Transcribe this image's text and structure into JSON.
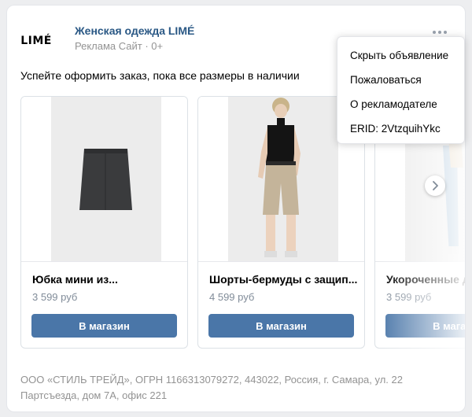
{
  "post": {
    "author": "Женская одежда LIMÉ",
    "meta": "Реклама Сайт · 0+",
    "text": "Успейте оформить заказ, пока все размеры в наличии",
    "logo_text": "LIMÉ",
    "menu_icon": "more-dots-icon"
  },
  "menu": {
    "items": [
      "Скрыть объявление",
      "Пожаловаться",
      "О рекламодателе",
      "ERID: 2VtzquihYkc"
    ]
  },
  "cards": [
    {
      "title": "Юбка мини из...",
      "price": "3 599 руб",
      "button": "В магазин"
    },
    {
      "title": "Шорты-бермуды с защип...",
      "price": "4 599 руб",
      "button": "В магазин"
    },
    {
      "title": "Укороченные д",
      "price": "3 599 руб",
      "button": "В магазин"
    }
  ],
  "footer": {
    "line1": "ООО «СТИЛЬ ТРЕЙД», ОГРН 1166313079272, 443022, Россия, г. Самара, ул. 22",
    "line2": "Партсъезда, дом 7А, офис 221"
  },
  "colors": {
    "link": "#2a5885",
    "button": "#4a76a8",
    "muted": "#939393"
  }
}
